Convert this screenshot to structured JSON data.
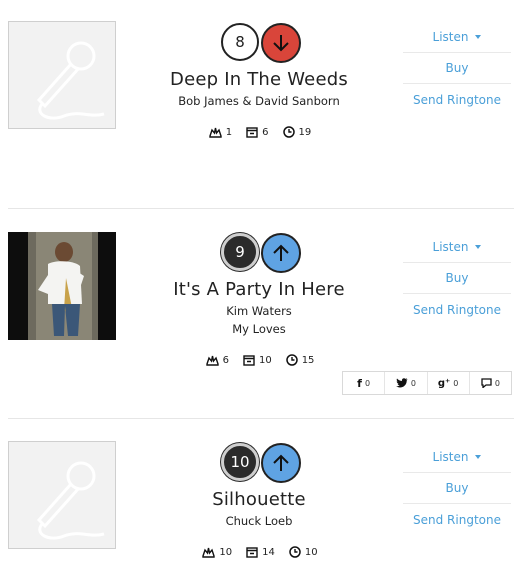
{
  "entries": [
    {
      "rank": "8",
      "movement": "down",
      "title": "Deep In The Weeds",
      "artist": "Bob James & David Sanborn",
      "album": "",
      "stats": {
        "peak": "1",
        "weeks_rank": "6",
        "weeks_on_chart": "19"
      },
      "actions": {
        "listen": "Listen",
        "buy": "Buy",
        "ringtone": "Send Ringtone"
      }
    },
    {
      "rank": "9",
      "movement": "up",
      "title": "It's A Party In Here",
      "artist": "Kim Waters",
      "album": "My Loves",
      "stats": {
        "peak": "6",
        "weeks_rank": "10",
        "weeks_on_chart": "15"
      },
      "actions": {
        "listen": "Listen",
        "buy": "Buy",
        "ringtone": "Send Ringtone"
      },
      "share": {
        "facebook": "0",
        "twitter": "0",
        "google_plus": "0",
        "comments": "0"
      }
    },
    {
      "rank": "10",
      "movement": "up",
      "title": "Silhouette",
      "artist": "Chuck Loeb",
      "album": "",
      "stats": {
        "peak": "10",
        "weeks_rank": "14",
        "weeks_on_chart": "10"
      },
      "actions": {
        "listen": "Listen",
        "buy": "Buy",
        "ringtone": "Send Ringtone"
      }
    }
  ],
  "colors": {
    "link": "#4a9fd8",
    "down": "#d9453a",
    "up": "#5fa3e3"
  },
  "icons": [
    "microphone-icon",
    "peak-crown-icon",
    "weeks-rank-icon",
    "clock-icon",
    "arrow-down-icon",
    "arrow-up-icon",
    "facebook-icon",
    "twitter-icon",
    "google-plus-icon",
    "comment-icon"
  ]
}
